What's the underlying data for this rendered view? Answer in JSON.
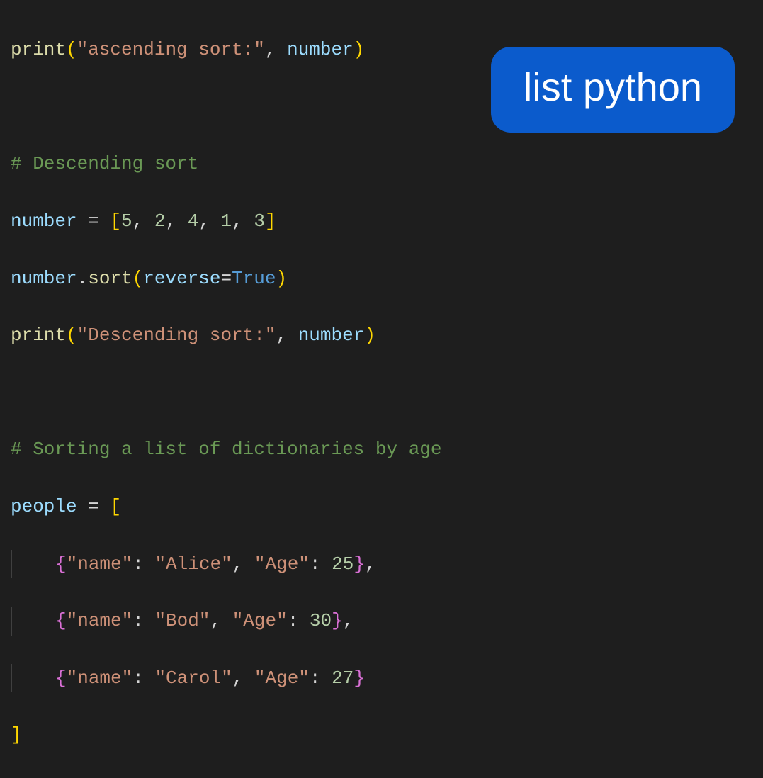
{
  "badge": {
    "text": "list python"
  },
  "code": {
    "line1": {
      "fn": "print",
      "lp": "(",
      "str": "\"ascending sort:\"",
      "comma": ", ",
      "arg": "number",
      "rp": ")"
    },
    "line3_comment": "# Descending sort",
    "line4": {
      "var": "number",
      "eq": " = ",
      "lb": "[",
      "n1": "5",
      "c1": ", ",
      "n2": "2",
      "c2": ", ",
      "n3": "4",
      "c3": ", ",
      "n4": "1",
      "c4": ", ",
      "n5": "3",
      "rb": "]"
    },
    "line5": {
      "obj": "number",
      "dot": ".",
      "method": "sort",
      "lp": "(",
      "kw": "reverse",
      "eq": "=",
      "val": "True",
      "rp": ")"
    },
    "line6": {
      "fn": "print",
      "lp": "(",
      "str": "\"Descending sort:\"",
      "comma": ", ",
      "arg": "number",
      "rp": ")"
    },
    "line8_comment": "# Sorting a list of dictionaries by age",
    "line9": {
      "var": "people",
      "eq": " = ",
      "lb": "["
    },
    "line10": {
      "lb": "{",
      "k1": "\"name\"",
      "c1": ": ",
      "v1": "\"Alice\"",
      "c2": ", ",
      "k2": "\"Age\"",
      "c3": ": ",
      "v2": "25",
      "rb": "}",
      "trail": ","
    },
    "line11": {
      "lb": "{",
      "k1": "\"name\"",
      "c1": ": ",
      "v1": "\"Bod\"",
      "c2": ", ",
      "k2": "\"Age\"",
      "c3": ": ",
      "v2": "30",
      "rb": "}",
      "trail": ","
    },
    "line12": {
      "lb": "{",
      "k1": "\"name\"",
      "c1": ": ",
      "v1": "\"Carol\"",
      "c2": ", ",
      "k2": "\"Age\"",
      "c3": ": ",
      "v2": "27",
      "rb": "}"
    },
    "line13": {
      "rb": "]"
    }
  }
}
